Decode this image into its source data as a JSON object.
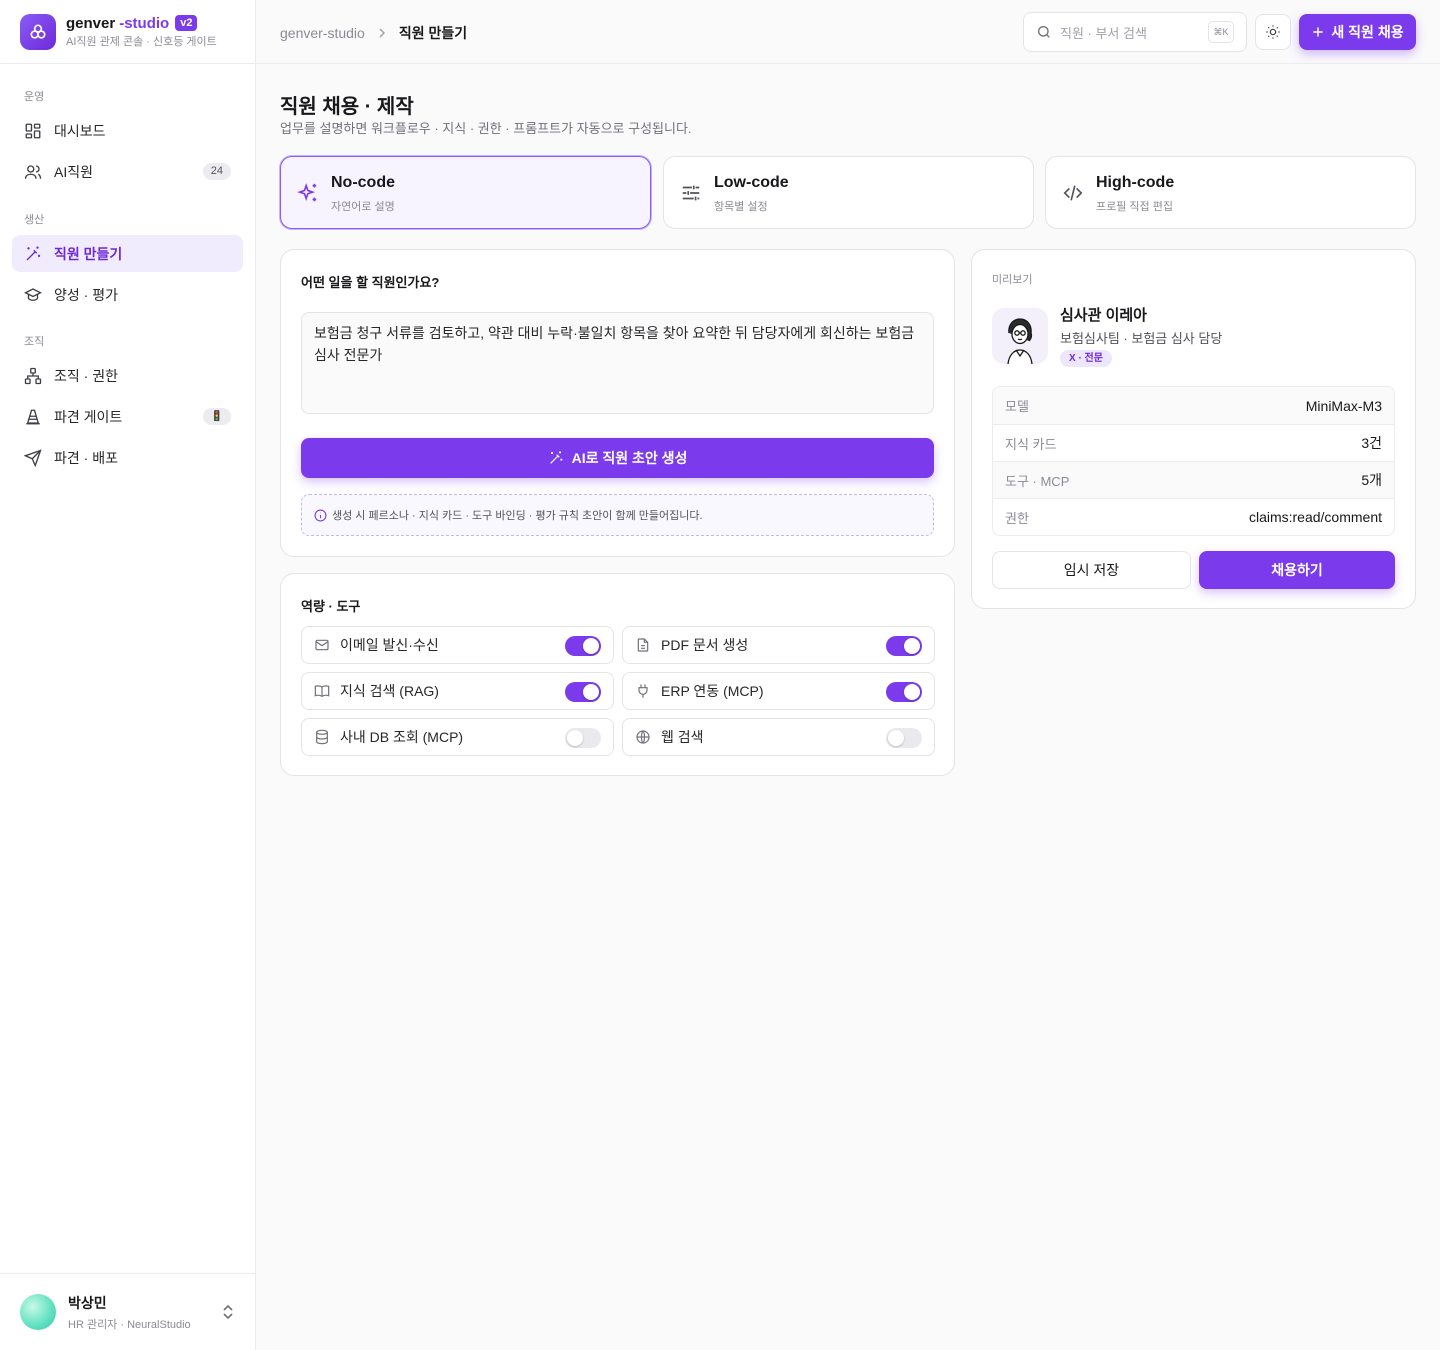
{
  "brand": {
    "name": "genver",
    "suffix": "-studio",
    "version": "v2",
    "subtitle": "AI직원 관제 콘솔 · 신호등 게이트"
  },
  "sidebar": {
    "sections": [
      {
        "label": "운영"
      },
      {
        "label": "생산"
      },
      {
        "label": "조직"
      }
    ],
    "items": [
      {
        "label": "대시보드",
        "icon": "dashboard-icon"
      },
      {
        "label": "AI직원",
        "icon": "users-icon",
        "badge": "24"
      },
      {
        "label": "직원 만들기",
        "icon": "magic-wand-icon",
        "active": true
      },
      {
        "label": "양성 · 평가",
        "icon": "graduation-cap-icon"
      },
      {
        "label": "조직 · 권한",
        "icon": "org-chart-icon"
      },
      {
        "label": "파견 게이트",
        "icon": "traffic-cone-icon",
        "badge": "🚦"
      },
      {
        "label": "파견 · 배포",
        "icon": "send-icon"
      }
    ]
  },
  "user": {
    "name": "박상민",
    "role": "HR 관리자 · NeuralStudio"
  },
  "topbar": {
    "breadcrumb_root": "genver-studio",
    "breadcrumb_current": "직원 만들기",
    "search_placeholder": "직원 · 부서 검색",
    "search_shortcut": "⌘K",
    "new_button": "새 직원 채용"
  },
  "page": {
    "title": "직원 채용 · 제작",
    "subtitle": "업무를 설명하면 워크플로우 · 지식 · 권한 · 프롬프트가 자동으로 구성됩니다."
  },
  "modes": [
    {
      "title": "No-code",
      "subtitle": "자연어로 설명",
      "icon": "sparkles-icon",
      "active": true
    },
    {
      "title": "Low-code",
      "subtitle": "항목별 설정",
      "icon": "sliders-icon",
      "active": false
    },
    {
      "title": "High-code",
      "subtitle": "프로필 직접 편집",
      "icon": "code-icon",
      "active": false
    }
  ],
  "composer": {
    "question": "어떤 일을 할 직원인가요?",
    "prompt": "보험금 청구 서류를 검토하고, 약관 대비 누락·불일치 항목을 찾아 요약한 뒤 담당자에게 회신하는 보험금 심사 전문가",
    "generate_button": "AI로 직원 초안 생성",
    "hint": "생성 시 페르소나 · 지식 카드 · 도구 바인딩 · 평가 규칙 초안이 함께 만들어집니다."
  },
  "capabilities": {
    "title": "역량 · 도구",
    "tools": [
      {
        "label": "이메일 발신·수신",
        "icon": "mail-icon",
        "enabled": true
      },
      {
        "label": "PDF 문서 생성",
        "icon": "file-icon",
        "enabled": true
      },
      {
        "label": "지식 검색 (RAG)",
        "icon": "book-icon",
        "enabled": true
      },
      {
        "label": "ERP 연동 (MCP)",
        "icon": "plug-icon",
        "enabled": true
      },
      {
        "label": "사내 DB 조회 (MCP)",
        "icon": "database-icon",
        "enabled": false
      },
      {
        "label": "웹 검색",
        "icon": "globe-icon",
        "enabled": false
      }
    ]
  },
  "preview": {
    "label": "미리보기",
    "name": "심사관 이레아",
    "team": "보험심사팀 · 보험금 심사 담당",
    "tag": "X · 전문",
    "rows": [
      {
        "key": "모델",
        "value": "MiniMax-M3"
      },
      {
        "key": "지식 카드",
        "value": "3건"
      },
      {
        "key": "도구 · MCP",
        "value": "5개"
      },
      {
        "key": "권한",
        "value": "claims:read/comment"
      }
    ],
    "save_button": "임시 저장",
    "hire_button": "채용하기"
  },
  "colors": {
    "accent": "#7c3aed",
    "accent_soft": "#f0ecfd"
  }
}
